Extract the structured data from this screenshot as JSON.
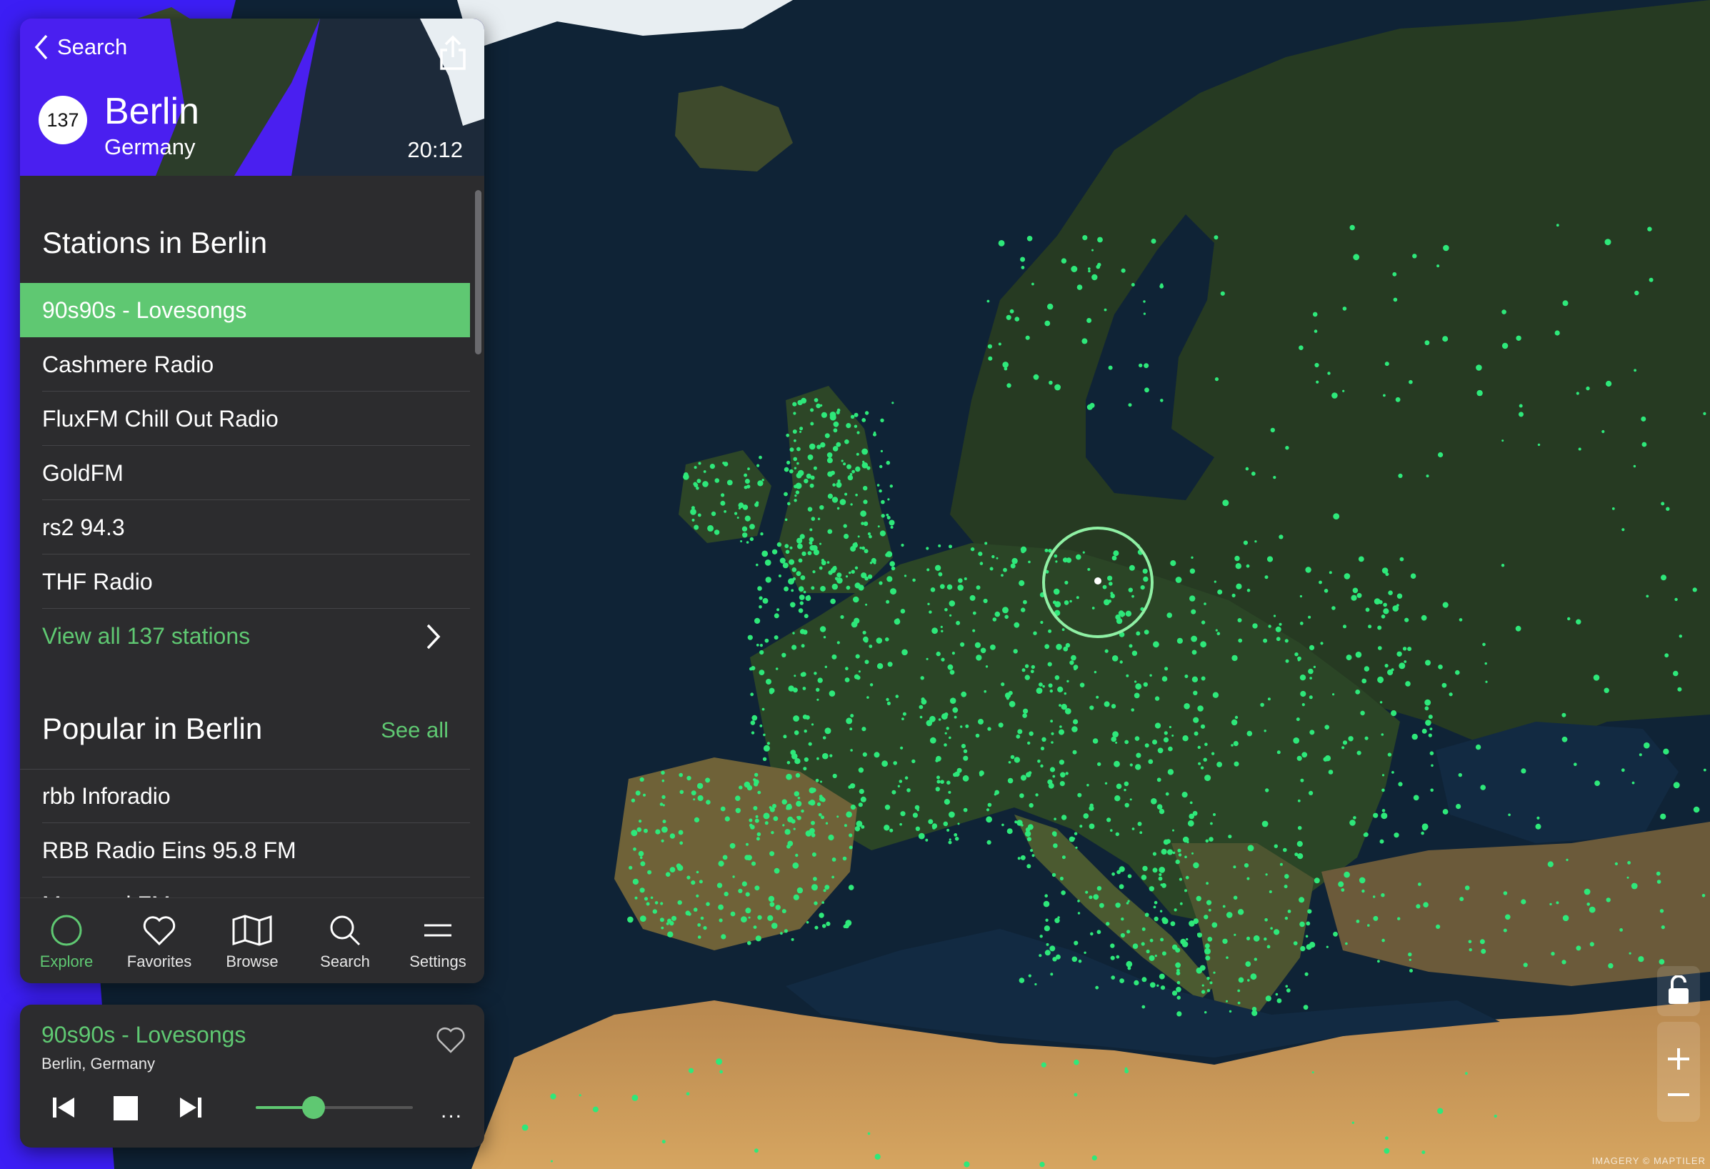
{
  "header": {
    "back_label": "Search",
    "station_count": "137",
    "city": "Berlin",
    "country": "Germany",
    "local_time": "20:12",
    "accent_color": "#4a1ff0"
  },
  "stations": {
    "title": "Stations in Berlin",
    "items": [
      {
        "label": "90s90s - Lovesongs",
        "active": true
      },
      {
        "label": "Cashmere Radio",
        "active": false
      },
      {
        "label": "FluxFM Chill Out Radio",
        "active": false
      },
      {
        "label": "GoldFM",
        "active": false
      },
      {
        "label": "rs2 94.3",
        "active": false
      },
      {
        "label": "THF Radio",
        "active": false
      }
    ],
    "view_all": "View all 137 stations"
  },
  "popular": {
    "title": "Popular in Berlin",
    "see_all": "See all",
    "items": [
      "rbb Inforadio",
      "RBB Radio Eins 95.8 FM",
      "Metropol FM"
    ]
  },
  "tabs": [
    {
      "label": "Explore",
      "icon": "circle-icon",
      "active": true
    },
    {
      "label": "Favorites",
      "icon": "heart-icon",
      "active": false
    },
    {
      "label": "Browse",
      "icon": "map-icon",
      "active": false
    },
    {
      "label": "Search",
      "icon": "search-icon",
      "active": false
    },
    {
      "label": "Settings",
      "icon": "menu-icon",
      "active": false
    }
  ],
  "player": {
    "title": "90s90s - Lovesongs",
    "subtitle": "Berlin, Germany",
    "volume": 0.37,
    "more": "..."
  },
  "map": {
    "attribution": "IMAGERY © MAPTILER",
    "station_dot_color": "#2ee87a",
    "selected_ring_color": "#8ff0a4"
  },
  "colors": {
    "accent_green": "#5fc872",
    "panel_bg": "#2c2c2e"
  }
}
